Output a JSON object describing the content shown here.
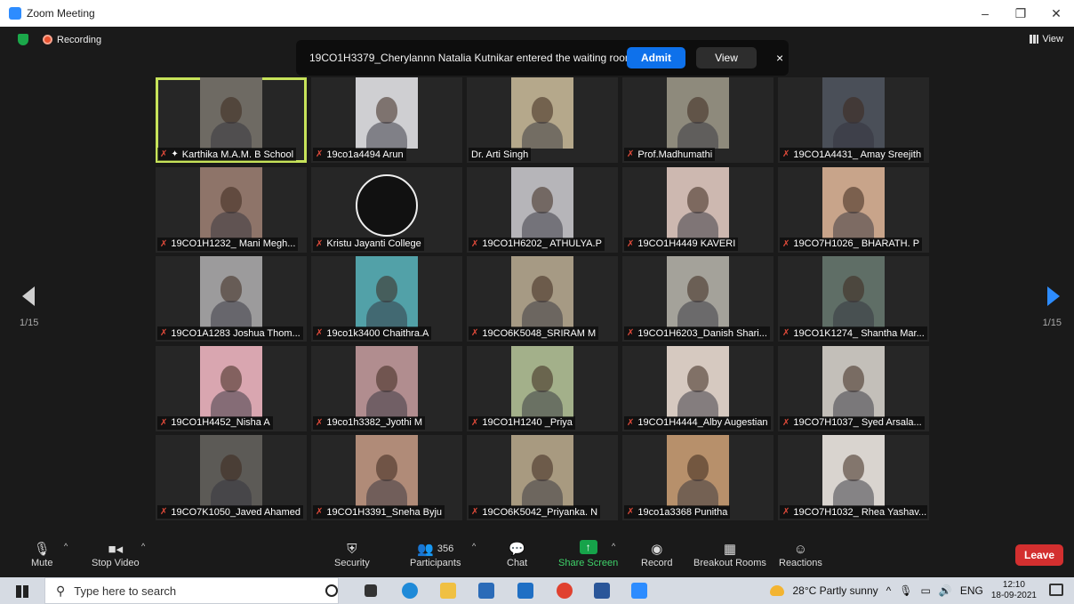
{
  "window": {
    "title": "Zoom Meeting",
    "controls": [
      "–",
      "❐",
      "✕"
    ]
  },
  "meeting": {
    "recording_label": "Recording",
    "view_label": "View",
    "notification": {
      "message": "19CO1H3379_Cherylannn Natalia Kutnikar entered the waiting room",
      "admit_label": "Admit",
      "view_label": "View",
      "close_label": "×"
    },
    "page_left": "1/15",
    "page_right": "1/15",
    "participants": [
      {
        "name": "Karthika M.A.M. B School",
        "muted": true,
        "pinned": true,
        "active": true,
        "bg": "#6e6a63"
      },
      {
        "name": "19co1a4494 Arun",
        "muted": true,
        "bg": "#cfcfd2"
      },
      {
        "name": "Dr. Arti Singh",
        "muted": false,
        "bg": "#b5a88b"
      },
      {
        "name": "Prof.Madhumathi",
        "muted": true,
        "bg": "#8e8a7c"
      },
      {
        "name": "19CO1A4431_ Amay Sreejith",
        "muted": true,
        "bg": "#4a4f58"
      },
      {
        "name": "19CO1H1232_ Mani Megh...",
        "muted": true,
        "bg": "#8e7469"
      },
      {
        "name": "Kristu Jayanti College",
        "muted": true,
        "logo": true,
        "bg": "#1d1d1d"
      },
      {
        "name": "19CO1H6202_ ATHULYA.P",
        "muted": true,
        "bg": "#b6b5b9"
      },
      {
        "name": "19CO1H4449 KAVERI",
        "muted": true,
        "bg": "#cdb8b0"
      },
      {
        "name": "19CO7H1026_ BHARATH. P",
        "muted": true,
        "bg": "#c8a48a"
      },
      {
        "name": "19CO1A1283 Joshua Thom...",
        "muted": true,
        "bg": "#9c9b9c"
      },
      {
        "name": "19co1k3400 Chaithra.A",
        "muted": true,
        "bg": "#52a1a8"
      },
      {
        "name": "19CO6K5048_SRIRAM M",
        "muted": true,
        "bg": "#a69a84"
      },
      {
        "name": "19CO1H6203_Danish Shari...",
        "muted": true,
        "bg": "#a4a29a"
      },
      {
        "name": "19CO1K1274_ Shantha Mar...",
        "muted": true,
        "bg": "#5f6e66"
      },
      {
        "name": "19CO1H4452_Nisha A",
        "muted": true,
        "bg": "#d9a6b0"
      },
      {
        "name": "19co1h3382_Jyothi M",
        "muted": true,
        "bg": "#b18d8f"
      },
      {
        "name": "19CO1H1240 _Priya",
        "muted": true,
        "bg": "#a3b08a"
      },
      {
        "name": "19CO1H4444_Alby Augestian",
        "muted": true,
        "bg": "#d6c9c0"
      },
      {
        "name": "19CO7H1037_ Syed Arsala...",
        "muted": true,
        "bg": "#c3bfb9"
      },
      {
        "name": "19CO7K1050_Javed Ahamed",
        "muted": true,
        "bg": "#5c5a56"
      },
      {
        "name": "19CO1H3391_Sneha Byju",
        "muted": true,
        "bg": "#b08b78"
      },
      {
        "name": "19CO6K5042_Priyanka. N",
        "muted": true,
        "bg": "#a89a80"
      },
      {
        "name": "19co1a3368 Punitha",
        "muted": true,
        "bg": "#b7906b"
      },
      {
        "name": "19CO7H1032_ Rhea Yashav...",
        "muted": true,
        "bg": "#d9d4cf"
      }
    ]
  },
  "toolbar": {
    "mute": "Mute",
    "stop_video": "Stop Video",
    "security": "Security",
    "participants": "Participants",
    "participants_count": "356",
    "chat": "Chat",
    "share_screen": "Share Screen",
    "record": "Record",
    "breakout_rooms": "Breakout Rooms",
    "reactions": "Reactions",
    "leave": "Leave"
  },
  "taskbar": {
    "search_placeholder": "Type here to search",
    "weather": "28°C  Partly sunny",
    "language": "ENG",
    "time": "12:10",
    "date": "18-09-2021"
  }
}
